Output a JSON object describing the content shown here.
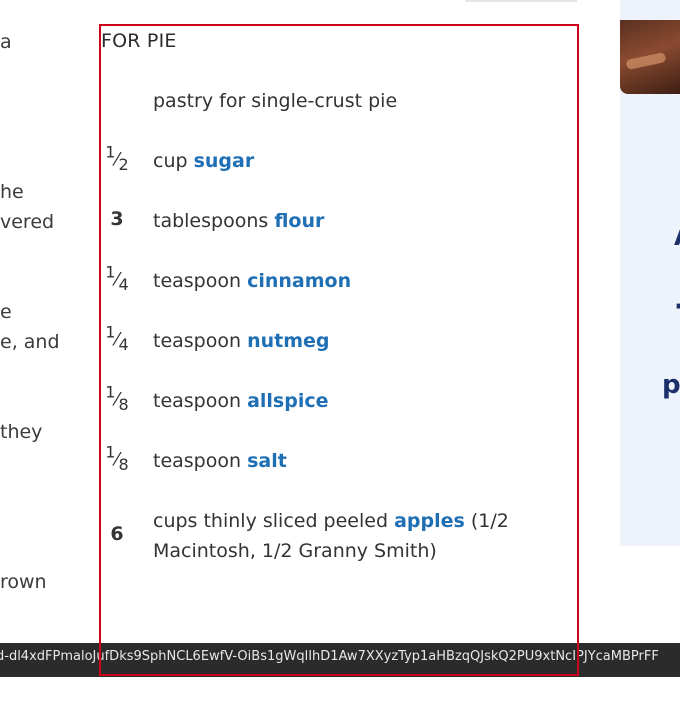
{
  "left_fragments": [
    "a",
    "he",
    "vered",
    "e",
    "e, and",
    "they",
    "rown"
  ],
  "section": {
    "title": "FOR PIE"
  },
  "ingredients": [
    {
      "qty": "",
      "num": "",
      "den": "",
      "text_before": "pastry for single-crust pie",
      "link": "",
      "text_after": ""
    },
    {
      "qty": "",
      "num": "1",
      "den": "2",
      "text_before": "cup ",
      "link": "sugar",
      "text_after": ""
    },
    {
      "qty": "3",
      "num": "",
      "den": "",
      "text_before": "tablespoons ",
      "link": "flour",
      "text_after": ""
    },
    {
      "qty": "",
      "num": "1",
      "den": "4",
      "text_before": "teaspoon ",
      "link": "cinnamon",
      "text_after": ""
    },
    {
      "qty": "",
      "num": "1",
      "den": "4",
      "text_before": "teaspoon ",
      "link": "nutmeg",
      "text_after": ""
    },
    {
      "qty": "",
      "num": "1",
      "den": "8",
      "text_before": "teaspoon ",
      "link": "allspice",
      "text_after": ""
    },
    {
      "qty": "",
      "num": "1",
      "den": "8",
      "text_before": "teaspoon ",
      "link": "salt",
      "text_after": ""
    },
    {
      "qty": "6",
      "num": "",
      "den": "",
      "text_before": "cups thinly sliced peeled ",
      "link": "apples",
      "text_after": " (1/2 Macintosh, 1/2 Granny Smith)"
    }
  ],
  "ad": {
    "letters": [
      "A",
      "·",
      "p"
    ]
  },
  "status_bar": {
    "url_text": "d-dl4xdFPmaloJufDks9SphNCL6EwfV-OiBs1gWqlIhD1Aw7XXyzTyp1aHBzqQJskQ2PU9xtNcIPJYcaMBPrFF"
  },
  "colors": {
    "link": "#1f6fb5",
    "highlight_border": "#d0021b",
    "status_bar_bg": "#2b2b2b",
    "ad_bg": "#eef3fb",
    "ad_text": "#1c2f6b"
  }
}
